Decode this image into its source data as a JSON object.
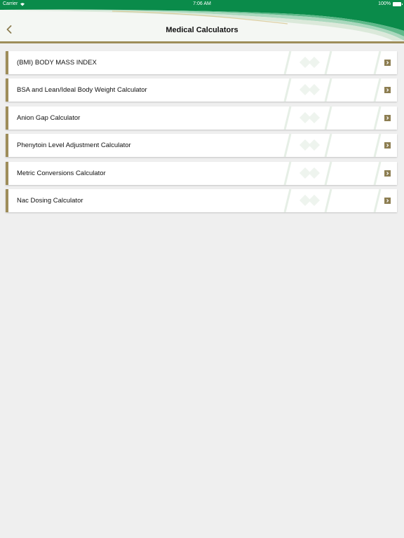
{
  "status_bar": {
    "carrier": "Carrier",
    "time": "7:06 AM",
    "battery": "100%"
  },
  "header": {
    "title": "Medical Calculators",
    "back_icon": "chevron-left-icon"
  },
  "colors": {
    "accent_gold": "#9e8d5a",
    "header_green": "#0a8b4a",
    "background": "#efefef"
  },
  "calculators": [
    {
      "label": "(BMI) BODY MASS INDEX",
      "icon": "chevron-right-icon"
    },
    {
      "label": "BSA and Lean/Ideal Body Weight Calculator",
      "icon": "chevron-right-icon"
    },
    {
      "label": "Anion Gap Calculator",
      "icon": "chevron-right-icon"
    },
    {
      "label": "Phenytoin Level Adjustment Calculator",
      "icon": "chevron-right-icon"
    },
    {
      "label": "Metric Conversions Calculator",
      "icon": "chevron-right-icon"
    },
    {
      "label": "Nac Dosing Calculator",
      "icon": "chevron-right-icon"
    }
  ]
}
